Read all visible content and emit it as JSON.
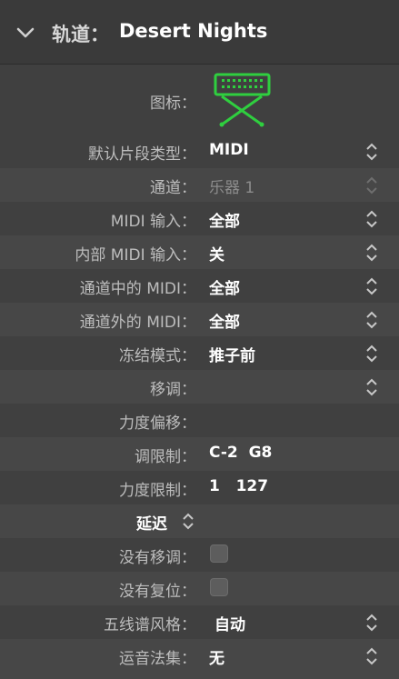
{
  "header": {
    "title_prefix": "轨道：",
    "title_name": "Desert Nights"
  },
  "icon_label": "图标：",
  "rows": [
    {
      "label": "默认片段类型：",
      "value": "MIDI"
    },
    {
      "label": "通道：",
      "value": "乐器 1"
    },
    {
      "label": "MIDI 输入：",
      "value": "全部"
    },
    {
      "label": "内部 MIDI 输入：",
      "value": "关"
    },
    {
      "label": "通道中的 MIDI：",
      "value": "全部"
    },
    {
      "label": "通道外的 MIDI：",
      "value": "全部"
    },
    {
      "label": "冻结模式：",
      "value": "推子前"
    },
    {
      "label": "移调：",
      "value": ""
    },
    {
      "label": "力度偏移：",
      "value": ""
    },
    {
      "label": "调限制：",
      "value": "C-2  G8"
    },
    {
      "label": "力度限制：",
      "value": "1   127"
    },
    {
      "label": "延迟",
      "value": ""
    },
    {
      "label": "没有移调：",
      "value": ""
    },
    {
      "label": "没有复位：",
      "value": ""
    },
    {
      "label": "五线谱风格：",
      "value": "自动"
    },
    {
      "label": "运音法集：",
      "value": "无"
    }
  ],
  "colors": {
    "background": "#404040",
    "header": "#3a3a3a",
    "icon_green": "#2fcf3f"
  },
  "icons": {
    "track_icon": "keyboard-stand-icon",
    "disclosure": "chevron-down-icon",
    "stepper": "up-down-stepper-icon"
  }
}
